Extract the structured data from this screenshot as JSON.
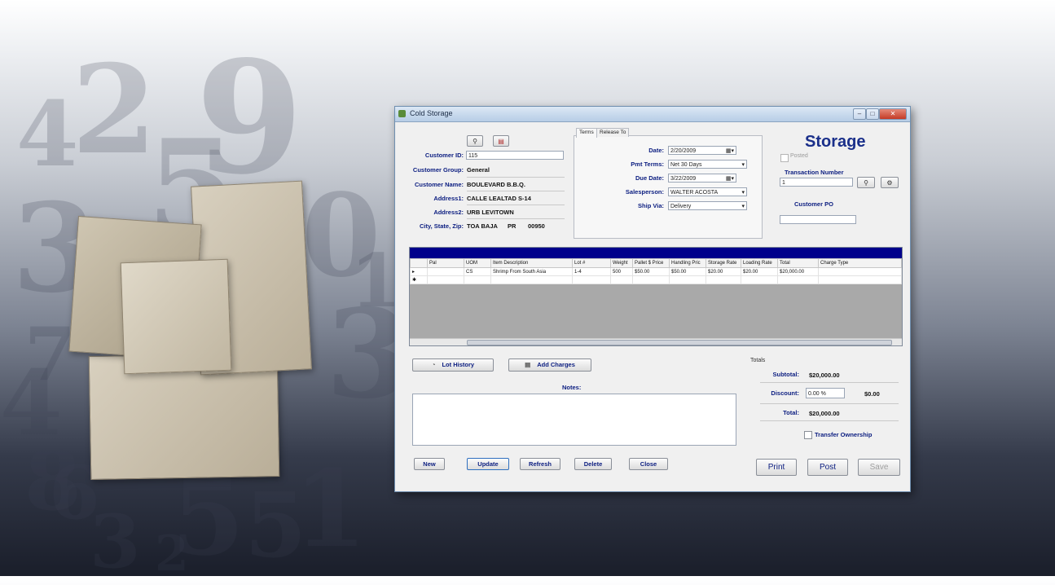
{
  "background_digits": [
    "2",
    "4",
    "9",
    "3",
    "0",
    "5",
    "7",
    "4",
    "3",
    "8",
    "1",
    "6",
    "3",
    "5",
    "5",
    "1",
    "2"
  ],
  "window": {
    "title": "Cold Storage",
    "form_title": "Storage"
  },
  "customer": {
    "id_label": "Customer ID:",
    "id_value": "115",
    "group_label": "Customer Group:",
    "group_value": "General",
    "name_label": "Customer Name:",
    "name_value": "BOULEVARD B.B.Q.",
    "address1_label": "Address1:",
    "address1_value": "CALLE LEALTAD S-14",
    "address2_label": "Address2:",
    "address2_value": "URB LEVITOWN",
    "csz_label": "City, State, Zip:",
    "city_value": "TOA BAJA",
    "state_value": "PR",
    "zip_value": "00950"
  },
  "tabs": [
    "Terms",
    "Release To"
  ],
  "terms": {
    "date_label": "Date:",
    "date_value": "2/20/2009",
    "pmt_terms_label": "Pmt Terms:",
    "pmt_terms_value": "Net 30 Days",
    "due_date_label": "Due Date:",
    "due_date_value": "3/22/2009",
    "salesperson_label": "Salesperson:",
    "salesperson_value": "WALTER ACOSTA",
    "ship_via_label": "Ship Via:",
    "ship_via_value": "Delivery"
  },
  "right_panel": {
    "posted_label": "Posted",
    "transaction_number_label": "Transaction Number",
    "transaction_number_value": "1",
    "customer_po_label": "Customer PO",
    "customer_po_value": ""
  },
  "grid": {
    "columns": [
      "Pal",
      "UOM",
      "Item Description",
      "Lot #",
      "Weight",
      "Pallet $ Price",
      "Handling Pric",
      "Storage Rate",
      "Loading Rate",
      "Total",
      "Charge Type"
    ],
    "rows": [
      [
        "",
        "CS",
        "Shrimp From South Asia",
        "1-4",
        "500",
        "$50.00",
        "$50.00",
        "$20.00",
        "$20.00",
        "$20,000.00",
        ""
      ],
      [
        "",
        "",
        "",
        "",
        "",
        "",
        "",
        "",
        "",
        "",
        ""
      ]
    ]
  },
  "actions": {
    "lot_history": "Lot History",
    "add_charges": "Add Charges",
    "notes_label": "Notes:"
  },
  "totals": {
    "group_label": "Totals",
    "subtotal_label": "Subtotal:",
    "subtotal_value": "$20,000.00",
    "discount_label": "Discount:",
    "discount_pct": "0.00 %",
    "discount_value": "$0.00",
    "total_label": "Total:",
    "total_value": "$20,000.00",
    "transfer_label": "Transfer Ownership"
  },
  "bottom_buttons": {
    "new": "New",
    "update": "Update",
    "refresh": "Refresh",
    "delete": "Delete",
    "close": "Close",
    "print": "Print",
    "post": "Post",
    "save": "Save"
  },
  "colors": {
    "label_blue": "#0b1d80",
    "grid_header_bar": "#00008b"
  }
}
